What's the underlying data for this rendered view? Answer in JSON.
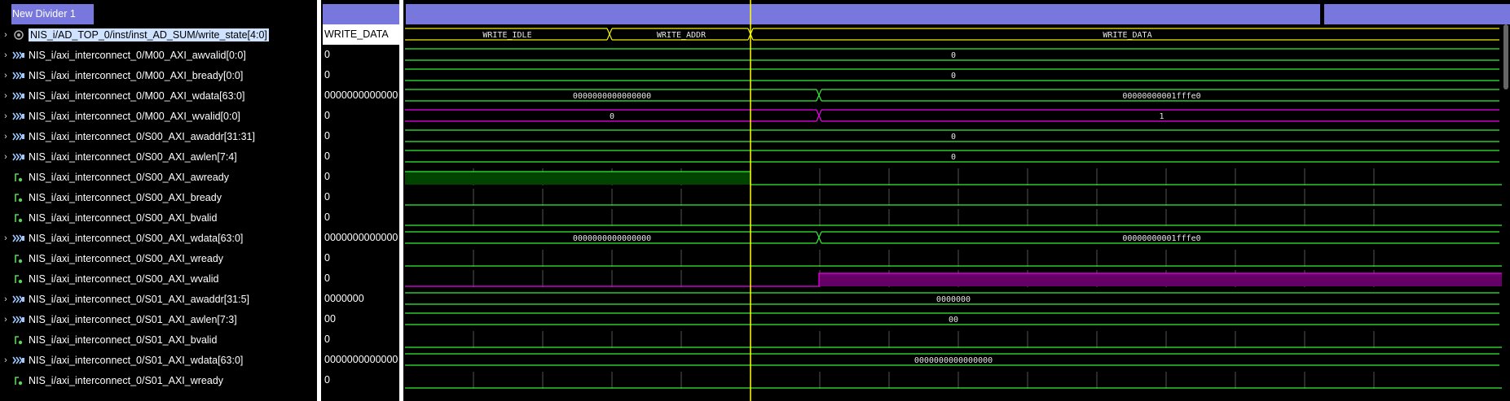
{
  "divider": {
    "label": "New Divider 1"
  },
  "signals": [
    {
      "name": "NIS_i/AD_TOP_0/inst/inst_AD_SUM/write_state[4:0]",
      "value": "WRITE_DATA",
      "kind": "state",
      "expandable": true,
      "selected": true
    },
    {
      "name": "NIS_i/axi_interconnect_0/M00_AXI_awvalid[0:0]",
      "value": "0",
      "kind": "bus",
      "expandable": true
    },
    {
      "name": "NIS_i/axi_interconnect_0/M00_AXI_bready[0:0]",
      "value": "0",
      "kind": "bus",
      "expandable": true
    },
    {
      "name": "NIS_i/axi_interconnect_0/M00_AXI_wdata[63:0]",
      "value": "0000000000000",
      "kind": "bus",
      "expandable": true
    },
    {
      "name": "NIS_i/axi_interconnect_0/M00_AXI_wvalid[0:0]",
      "value": "0",
      "kind": "bus",
      "expandable": true
    },
    {
      "name": "NIS_i/axi_interconnect_0/S00_AXI_awaddr[31:31]",
      "value": "0",
      "kind": "bus",
      "expandable": true
    },
    {
      "name": "NIS_i/axi_interconnect_0/S00_AXI_awlen[7:4]",
      "value": "0",
      "kind": "bus",
      "expandable": true
    },
    {
      "name": "NIS_i/axi_interconnect_0/S00_AXI_awready",
      "value": "0",
      "kind": "bit",
      "expandable": false
    },
    {
      "name": "NIS_i/axi_interconnect_0/S00_AXI_bready",
      "value": "0",
      "kind": "bit",
      "expandable": false
    },
    {
      "name": "NIS_i/axi_interconnect_0/S00_AXI_bvalid",
      "value": "0",
      "kind": "bit",
      "expandable": false
    },
    {
      "name": "NIS_i/axi_interconnect_0/S00_AXI_wdata[63:0]",
      "value": "0000000000000",
      "kind": "bus",
      "expandable": true
    },
    {
      "name": "NIS_i/axi_interconnect_0/S00_AXI_wready",
      "value": "0",
      "kind": "bit",
      "expandable": false
    },
    {
      "name": "NIS_i/axi_interconnect_0/S00_AXI_wvalid",
      "value": "0",
      "kind": "bit",
      "expandable": false
    },
    {
      "name": "NIS_i/axi_interconnect_0/S01_AXI_awaddr[31:5]",
      "value": "0000000",
      "kind": "bus",
      "expandable": true
    },
    {
      "name": "NIS_i/axi_interconnect_0/S01_AXI_awlen[7:3]",
      "value": "00",
      "kind": "bus",
      "expandable": true
    },
    {
      "name": "NIS_i/axi_interconnect_0/S01_AXI_bvalid",
      "value": "0",
      "kind": "bit",
      "expandable": false
    },
    {
      "name": "NIS_i/axi_interconnect_0/S01_AXI_wdata[63:0]",
      "value": "0000000000000",
      "kind": "bus",
      "expandable": true
    },
    {
      "name": "NIS_i/axi_interconnect_0/S01_AXI_wready",
      "value": "0",
      "kind": "bit",
      "expandable": false
    }
  ],
  "waveforms": {
    "state_labels": [
      "WRITE_IDLE",
      "WRITE_ADDR",
      "WRITE_DATA"
    ],
    "wdata_before": "0000000000000000",
    "wdata_after": "00000000001fffe0",
    "wvalid_before": "0",
    "wvalid_after": "1",
    "zero": "0",
    "s01_awaddr": "0000000",
    "s01_awlen": "00",
    "s01_wdata": "0000000000000000"
  },
  "colors": {
    "bus": "#33ee33",
    "state": "#eeee00",
    "cursor": "#ffff00",
    "highlight": "#ee00ee",
    "divider": "#7777dd",
    "grid": "#555555",
    "awready_fill": "#004400",
    "wvalid_fill": "#660066"
  }
}
